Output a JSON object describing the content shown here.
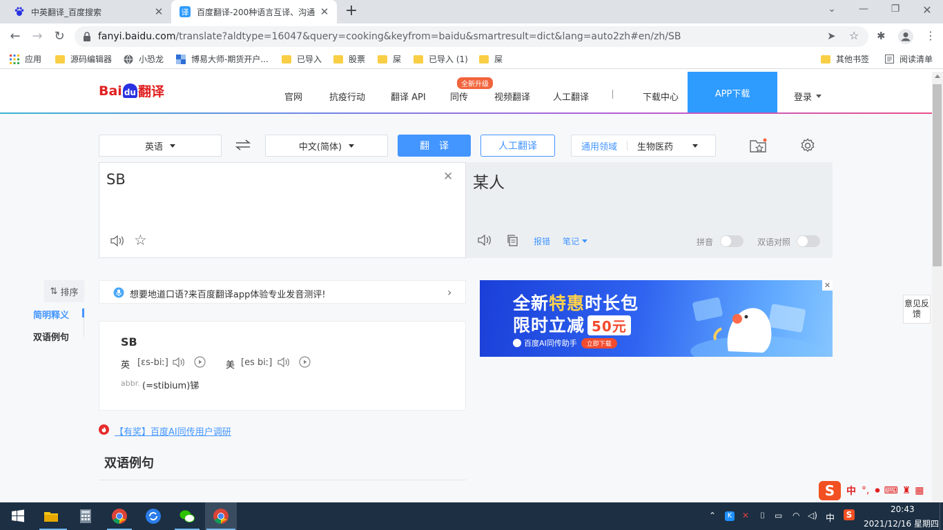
{
  "browser": {
    "tabs": [
      {
        "title": "中英翻译_百度搜索",
        "active": false
      },
      {
        "title": "百度翻译-200种语言互译、沟通",
        "active": true
      }
    ],
    "url_host": "fanyi.baidu.com",
    "url_path": "/translate?aldtype=16047&query=cooking&keyfrom=baidu&smartresult=dict&lang=auto2zh#en/zh/SB",
    "bookmarks": [
      {
        "label": "应用",
        "icon": "apps-grid-icon"
      },
      {
        "label": "源码编辑器",
        "icon": "folder-icon"
      },
      {
        "label": "小恐龙",
        "icon": "globe-icon"
      },
      {
        "label": "博易大师-期货开户...",
        "icon": "site-icon"
      },
      {
        "label": "已导入",
        "icon": "folder-icon"
      },
      {
        "label": "股票",
        "icon": "folder-icon"
      },
      {
        "label": "屎",
        "icon": "folder-icon"
      },
      {
        "label": "已导入 (1)",
        "icon": "folder-icon"
      },
      {
        "label": "屎",
        "icon": "folder-icon"
      }
    ],
    "other_bookmarks": "其他书签",
    "reading_list": "阅读清单"
  },
  "site": {
    "logo_text_bai": "Bai",
    "logo_text_du": "du",
    "logo_text_fanyi": "翻译",
    "nav": [
      "官网",
      "抗疫行动",
      "翻译 API",
      "同传",
      "视频翻译",
      "人工翻译",
      "下载中心"
    ],
    "badge": "全新升级",
    "app_download": "APP下载",
    "login": "登录"
  },
  "translator": {
    "source_lang": "英语",
    "target_lang": "中文(简体)",
    "translate_btn": "翻　译",
    "human_btn": "人工翻译",
    "domain_label": "通用领域",
    "domain_value": "生物医药",
    "source_text": "SB",
    "target_text": "某人",
    "report": "报错",
    "notes": "笔记",
    "pinyin": "拼音",
    "bilingual": "双语对照"
  },
  "sidebar": {
    "sort": "排序",
    "items": [
      "简明释义",
      "双语例句"
    ]
  },
  "promo": {
    "text": "想要地道口语?来百度翻译app体验专业发音测评!"
  },
  "dict": {
    "word": "SB",
    "uk_label": "英",
    "uk_phon": "[ɛs-biː]",
    "us_label": "美",
    "us_phon": "[es biː]",
    "pos": "abbr.",
    "def": "(=stibium)锑"
  },
  "survey_link": "【有奖】百度AI同传用户调研",
  "examples_heading": "双语例句",
  "ad": {
    "line1a": "全新",
    "line1b": "特惠",
    "line1c": "时长包",
    "line2a": "限时立减",
    "line2b": "50元",
    "brand": "百度AI同传助手",
    "cta": "立即下载"
  },
  "feedback": "意见反馈",
  "ime": {
    "lang": "中"
  },
  "taskbar": {
    "time": "20:43",
    "date": "2021/12/16 星期四",
    "ime": "中"
  },
  "colors": {
    "accent": "#2e9bff",
    "baidu_red": "#e02020",
    "baidu_blue": "#2932e1",
    "taskbar": "#1c2f43"
  }
}
